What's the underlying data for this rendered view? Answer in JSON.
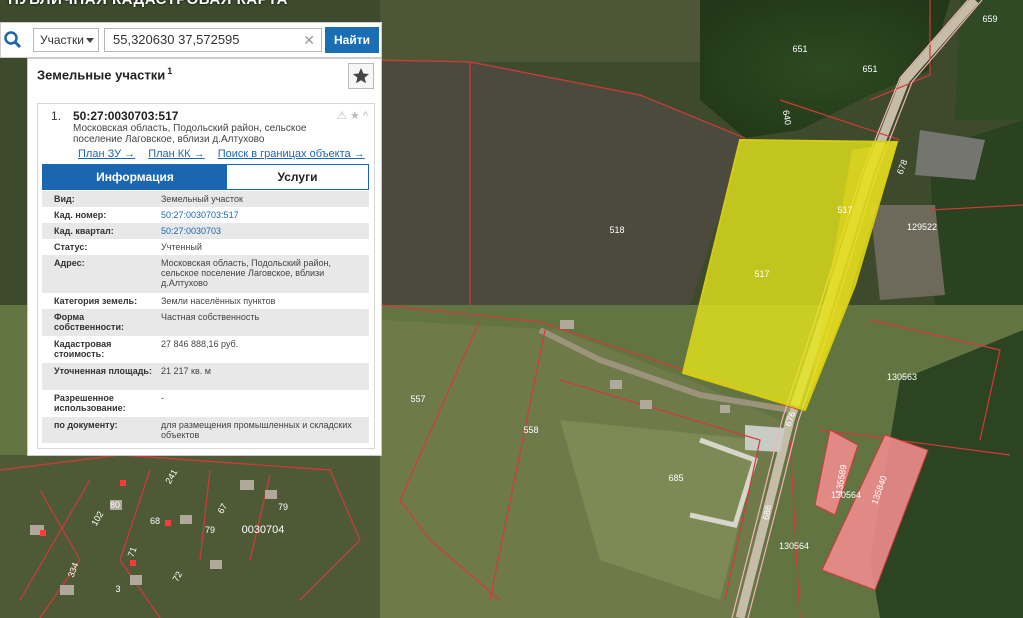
{
  "app_title": "ПУБЛИЧНАЯ КАДАСТРОВАЯ КАРТА",
  "search": {
    "type_label": "Участки",
    "value": "55,320630 37,572595",
    "clear_glyph": "✕",
    "button_label": "Найти"
  },
  "panel": {
    "title": "Земельные участки",
    "count": "1",
    "favorite_glyph": "★",
    "result": {
      "number": "1.",
      "cadastral_id": "50:27:0030703:517",
      "address": "Московская область, Подольский район, сельское поселение Лаговское, вблизи д.Алтухово",
      "action_glyphs": "⚠ ★ ^",
      "links": [
        "План ЗУ →",
        "План КК →",
        "Поиск в границах объекта →"
      ],
      "tabs": {
        "info": "Информация",
        "services": "Услуги"
      },
      "properties": [
        {
          "label": "Вид:",
          "value": "Земельный участок"
        },
        {
          "label": "Кад. номер:",
          "value": "50:27:0030703:517"
        },
        {
          "label": "Кад. квартал:",
          "value": "50:27:0030703"
        },
        {
          "label": "Статус:",
          "value": "Учтенный"
        },
        {
          "label": "Адрес:",
          "value": "Московская область, Подольский район, сельское поселение Лаговское, вблизи д.Алтухово"
        },
        {
          "label": "Категория земель:",
          "value": "Земли населённых пунктов"
        },
        {
          "label": "Форма собственности:",
          "value": "Частная собственность"
        },
        {
          "label": "Кадастровая стоимость:",
          "value": "27 846 888,16 руб."
        },
        {
          "label": "Уточненная площадь:",
          "value": "21 217 кв. м"
        },
        {
          "label": "Разрешенное использование:",
          "value": "-"
        },
        {
          "label": "по документу:",
          "value": "для размещения промышленных и складских объектов"
        }
      ]
    }
  },
  "map": {
    "parcel_labels": [
      "659",
      "651",
      "651",
      "640",
      "518",
      "517",
      "517",
      "678",
      "129522",
      "130563",
      "557",
      "558",
      "685",
      "676",
      "686",
      "135589",
      "130564",
      "135840",
      "130564",
      "0030704",
      "79",
      "80",
      "241",
      "68",
      "102",
      "67",
      "79",
      "71",
      "334",
      "72",
      "3"
    ],
    "colors": {
      "selected_parcel": "#e8e81a",
      "boundary": "#d23a3a",
      "building_fill": "#f08c8c"
    }
  }
}
